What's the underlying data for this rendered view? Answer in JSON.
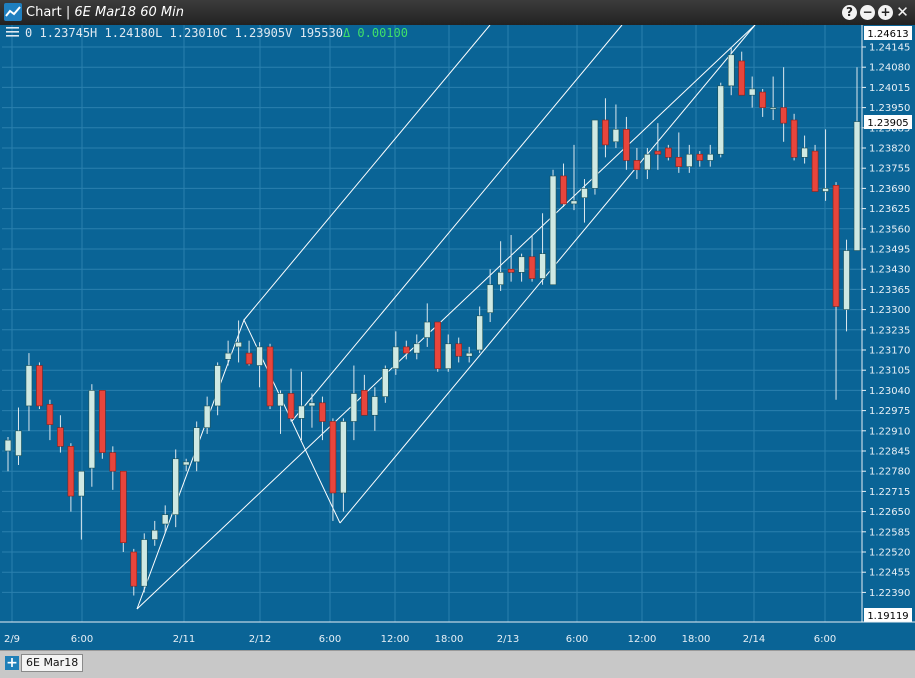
{
  "window": {
    "app_title": "Chart",
    "chart_title": "6E Mar18 60 Min"
  },
  "info": {
    "index": "0",
    "high": "1.23745H",
    "low": "1.24180L",
    "close": "1.23010C",
    "last": "1.23905V",
    "volume": "195530",
    "change": "Δ  0.00100"
  },
  "price_labels": {
    "top": "1.24613",
    "current": "1.23905",
    "bottom": "1.19119"
  },
  "tabs": [
    {
      "label": "6E Mar18"
    }
  ],
  "colors": {
    "background": "#0a6496",
    "up_candle": "#cfe9e3",
    "down_candle": "#e8453c",
    "wick": "#dce8ee",
    "trendline": "#ffffff",
    "grid": "#2a80ae",
    "change_text": "#3fe06a"
  },
  "chart_data": {
    "type": "candlestick",
    "title": "6E Mar18 60 Min",
    "y_ticks": [
      "1.24145",
      "1.24080",
      "1.24015",
      "1.23950",
      "1.23885",
      "1.23820",
      "1.23755",
      "1.23690",
      "1.23625",
      "1.23560",
      "1.23495",
      "1.23430",
      "1.23365",
      "1.23300",
      "1.23235",
      "1.23170",
      "1.23105",
      "1.23040",
      "1.22975",
      "1.22910",
      "1.22845",
      "1.22780",
      "1.22715",
      "1.22650",
      "1.22585",
      "1.22520",
      "1.22455",
      "1.22390"
    ],
    "x_ticks": [
      "2/9",
      "6:00",
      "2/11",
      "2/12",
      "6:00",
      "12:00",
      "18:00",
      "2/13",
      "6:00",
      "12:00",
      "18:00",
      "2/14",
      "6:00"
    ],
    "ylim": [
      1.22352,
      1.24186
    ],
    "grid": true,
    "candles": [
      {
        "o": 1.22845,
        "h": 1.2289,
        "l": 1.2278,
        "c": 1.2288
      },
      {
        "o": 1.2283,
        "h": 1.22985,
        "l": 1.228,
        "c": 1.2291
      },
      {
        "o": 1.2299,
        "h": 1.2316,
        "l": 1.2291,
        "c": 1.2312
      },
      {
        "o": 1.2312,
        "h": 1.2313,
        "l": 1.2298,
        "c": 1.2299
      },
      {
        "o": 1.22995,
        "h": 1.2301,
        "l": 1.2288,
        "c": 1.2293
      },
      {
        "o": 1.2292,
        "h": 1.2296,
        "l": 1.2284,
        "c": 1.2286
      },
      {
        "o": 1.2286,
        "h": 1.2287,
        "l": 1.2265,
        "c": 1.227
      },
      {
        "o": 1.227,
        "h": 1.2278,
        "l": 1.2256,
        "c": 1.2278
      },
      {
        "o": 1.2279,
        "h": 1.2306,
        "l": 1.2273,
        "c": 1.2304
      },
      {
        "o": 1.2304,
        "h": 1.2304,
        "l": 1.2282,
        "c": 1.2284
      },
      {
        "o": 1.2284,
        "h": 1.2286,
        "l": 1.2272,
        "c": 1.2278
      },
      {
        "o": 1.2278,
        "h": 1.2278,
        "l": 1.2252,
        "c": 1.2255
      },
      {
        "o": 1.2252,
        "h": 1.2253,
        "l": 1.2238,
        "c": 1.2241
      },
      {
        "o": 1.2241,
        "h": 1.2258,
        "l": 1.2239,
        "c": 1.2256
      },
      {
        "o": 1.2256,
        "h": 1.2262,
        "l": 1.2254,
        "c": 1.2259
      },
      {
        "o": 1.2261,
        "h": 1.2267,
        "l": 1.2258,
        "c": 1.2264
      },
      {
        "o": 1.2264,
        "h": 1.2285,
        "l": 1.226,
        "c": 1.2282
      },
      {
        "o": 1.228,
        "h": 1.2282,
        "l": 1.2278,
        "c": 1.2281
      },
      {
        "o": 1.2281,
        "h": 1.2294,
        "l": 1.2278,
        "c": 1.2292
      },
      {
        "o": 1.2292,
        "h": 1.2302,
        "l": 1.229,
        "c": 1.2299
      },
      {
        "o": 1.2299,
        "h": 1.2313,
        "l": 1.2296,
        "c": 1.2312
      },
      {
        "o": 1.2314,
        "h": 1.232,
        "l": 1.2312,
        "c": 1.2316
      },
      {
        "o": 1.2318,
        "h": 1.23265,
        "l": 1.2313,
        "c": 1.23195
      },
      {
        "o": 1.2316,
        "h": 1.232,
        "l": 1.2312,
        "c": 1.23125
      },
      {
        "o": 1.2312,
        "h": 1.23195,
        "l": 1.2305,
        "c": 1.2318
      },
      {
        "o": 1.2318,
        "h": 1.2319,
        "l": 1.2298,
        "c": 1.2299
      },
      {
        "o": 1.2299,
        "h": 1.2304,
        "l": 1.229,
        "c": 1.2303
      },
      {
        "o": 1.2303,
        "h": 1.2311,
        "l": 1.2294,
        "c": 1.2295
      },
      {
        "o": 1.2295,
        "h": 1.231,
        "l": 1.2288,
        "c": 1.2299
      },
      {
        "o": 1.2299,
        "h": 1.2303,
        "l": 1.2292,
        "c": 1.23
      },
      {
        "o": 1.23,
        "h": 1.2302,
        "l": 1.2288,
        "c": 1.2294
      },
      {
        "o": 1.2294,
        "h": 1.2295,
        "l": 1.2262,
        "c": 1.2271
      },
      {
        "o": 1.2271,
        "h": 1.2295,
        "l": 1.2265,
        "c": 1.2294
      },
      {
        "o": 1.2294,
        "h": 1.2312,
        "l": 1.2288,
        "c": 1.2303
      },
      {
        "o": 1.2304,
        "h": 1.2309,
        "l": 1.2296,
        "c": 1.2296
      },
      {
        "o": 1.2296,
        "h": 1.2305,
        "l": 1.2291,
        "c": 1.2302
      },
      {
        "o": 1.2302,
        "h": 1.2312,
        "l": 1.23,
        "c": 1.2311
      },
      {
        "o": 1.2311,
        "h": 1.2323,
        "l": 1.2309,
        "c": 1.2318
      },
      {
        "o": 1.2318,
        "h": 1.232,
        "l": 1.2314,
        "c": 1.2316
      },
      {
        "o": 1.2316,
        "h": 1.2322,
        "l": 1.2314,
        "c": 1.2319
      },
      {
        "o": 1.2321,
        "h": 1.2332,
        "l": 1.2318,
        "c": 1.2326
      },
      {
        "o": 1.2326,
        "h": 1.2326,
        "l": 1.231,
        "c": 1.2311
      },
      {
        "o": 1.2311,
        "h": 1.2322,
        "l": 1.231,
        "c": 1.2319
      },
      {
        "o": 1.2319,
        "h": 1.2321,
        "l": 1.2313,
        "c": 1.2315
      },
      {
        "o": 1.2315,
        "h": 1.2318,
        "l": 1.2313,
        "c": 1.2316
      },
      {
        "o": 1.2317,
        "h": 1.2331,
        "l": 1.2316,
        "c": 1.2328
      },
      {
        "o": 1.2329,
        "h": 1.2343,
        "l": 1.2326,
        "c": 1.2338
      },
      {
        "o": 1.2338,
        "h": 1.2352,
        "l": 1.2336,
        "c": 1.2342
      },
      {
        "o": 1.2343,
        "h": 1.2354,
        "l": 1.2339,
        "c": 1.2342
      },
      {
        "o": 1.2342,
        "h": 1.2348,
        "l": 1.2339,
        "c": 1.2347
      },
      {
        "o": 1.2347,
        "h": 1.2354,
        "l": 1.2339,
        "c": 1.234
      },
      {
        "o": 1.234,
        "h": 1.2361,
        "l": 1.2338,
        "c": 1.2348
      },
      {
        "o": 1.2338,
        "h": 1.2375,
        "l": 1.2338,
        "c": 1.2373
      },
      {
        "o": 1.2373,
        "h": 1.2377,
        "l": 1.2363,
        "c": 1.2364
      },
      {
        "o": 1.2364,
        "h": 1.2383,
        "l": 1.2362,
        "c": 1.2365
      },
      {
        "o": 1.2366,
        "h": 1.2372,
        "l": 1.2358,
        "c": 1.2369
      },
      {
        "o": 1.2369,
        "h": 1.2391,
        "l": 1.2367,
        "c": 1.2391
      },
      {
        "o": 1.2391,
        "h": 1.2398,
        "l": 1.2379,
        "c": 1.2383
      },
      {
        "o": 1.2384,
        "h": 1.2396,
        "l": 1.2382,
        "c": 1.2388
      },
      {
        "o": 1.2388,
        "h": 1.2392,
        "l": 1.2375,
        "c": 1.2378
      },
      {
        "o": 1.2378,
        "h": 1.2382,
        "l": 1.2372,
        "c": 1.2375
      },
      {
        "o": 1.2375,
        "h": 1.2382,
        "l": 1.2372,
        "c": 1.238
      },
      {
        "o": 1.2381,
        "h": 1.239,
        "l": 1.2375,
        "c": 1.238
      },
      {
        "o": 1.2382,
        "h": 1.2383,
        "l": 1.2378,
        "c": 1.2379
      },
      {
        "o": 1.2379,
        "h": 1.2387,
        "l": 1.2374,
        "c": 1.2376
      },
      {
        "o": 1.2376,
        "h": 1.2383,
        "l": 1.2374,
        "c": 1.238
      },
      {
        "o": 1.238,
        "h": 1.2381,
        "l": 1.2376,
        "c": 1.2378
      },
      {
        "o": 1.2378,
        "h": 1.2383,
        "l": 1.2376,
        "c": 1.238
      },
      {
        "o": 1.238,
        "h": 1.2403,
        "l": 1.2379,
        "c": 1.2402
      },
      {
        "o": 1.2402,
        "h": 1.24145,
        "l": 1.2399,
        "c": 1.2412
      },
      {
        "o": 1.241,
        "h": 1.2413,
        "l": 1.2399,
        "c": 1.2399
      },
      {
        "o": 1.2399,
        "h": 1.2405,
        "l": 1.2395,
        "c": 1.2401
      },
      {
        "o": 1.24,
        "h": 1.2401,
        "l": 1.2392,
        "c": 1.2395
      },
      {
        "o": 1.2395,
        "h": 1.2405,
        "l": 1.2391,
        "c": 1.2395
      },
      {
        "o": 1.2395,
        "h": 1.2408,
        "l": 1.2384,
        "c": 1.239
      },
      {
        "o": 1.2391,
        "h": 1.2393,
        "l": 1.2378,
        "c": 1.2379
      },
      {
        "o": 1.2379,
        "h": 1.2386,
        "l": 1.2377,
        "c": 1.2382
      },
      {
        "o": 1.2381,
        "h": 1.2383,
        "l": 1.2368,
        "c": 1.2368
      },
      {
        "o": 1.2368,
        "h": 1.2388,
        "l": 1.2365,
        "c": 1.2369
      },
      {
        "o": 1.237,
        "h": 1.2371,
        "l": 1.2301,
        "c": 1.2331
      },
      {
        "o": 1.233,
        "h": 1.23525,
        "l": 1.2323,
        "c": 1.2349
      },
      {
        "o": 1.2349,
        "h": 1.2408,
        "l": 1.2349,
        "c": 1.23905
      }
    ]
  }
}
